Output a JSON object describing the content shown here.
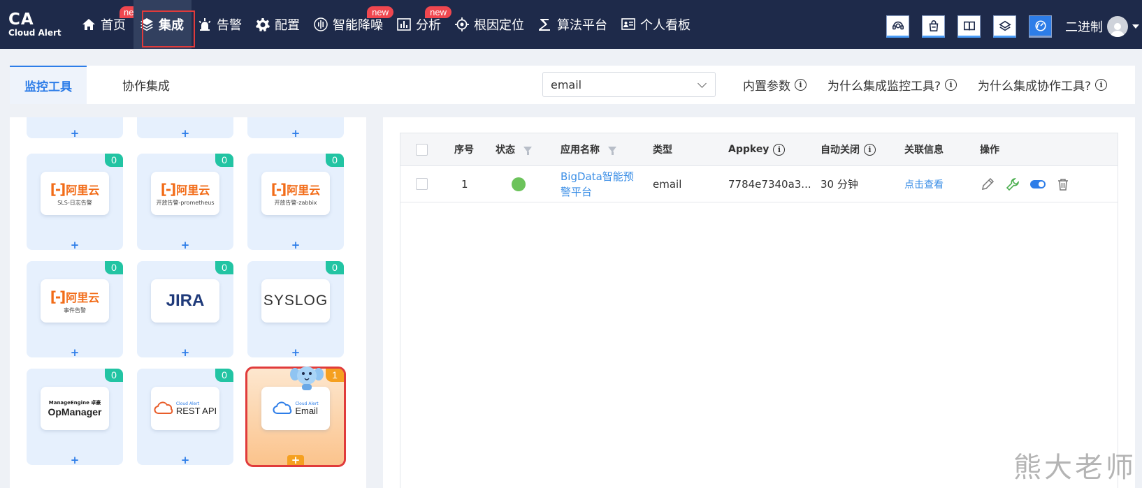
{
  "logo": {
    "big": "CA",
    "small": "Cloud Alert"
  },
  "nav": [
    {
      "label": "首页",
      "icon": "home-icon",
      "badge": "ne"
    },
    {
      "label": "集成",
      "icon": "layers-icon",
      "active": true
    },
    {
      "label": "告警",
      "icon": "alarm-icon"
    },
    {
      "label": "配置",
      "icon": "gear-icon"
    },
    {
      "label": "智能降噪",
      "icon": "waveform-icon",
      "badge": "new"
    },
    {
      "label": "分析",
      "icon": "bar-chart-icon",
      "badge": "new"
    },
    {
      "label": "根因定位",
      "icon": "target-icon"
    },
    {
      "label": "算法平台",
      "icon": "algorithm-icon"
    },
    {
      "label": "个人看板",
      "icon": "dashboard-icon"
    }
  ],
  "toolbar_icons": [
    "support-icon",
    "bag-icon",
    "book-icon",
    "layers-icon",
    "speed-icon"
  ],
  "user": {
    "name": "二进制"
  },
  "tabs": {
    "monitor": "监控工具",
    "collab": "协作集成"
  },
  "search": {
    "value": "email"
  },
  "links": {
    "builtin": "内置参数",
    "why_monitor": "为什么集成监控工具?",
    "why_collab": "为什么集成协作工具?"
  },
  "cards": {
    "plus": "+",
    "c1": {
      "count": "0",
      "brand": "阿里云",
      "sub": "SLS-日志告警"
    },
    "c2": {
      "count": "0",
      "brand": "阿里云",
      "sub": "开放告警-prometheus"
    },
    "c3": {
      "count": "0",
      "brand": "阿里云",
      "sub": "开放告警-zabbix"
    },
    "c4": {
      "count": "0",
      "brand": "阿里云",
      "sub": "事件告警"
    },
    "c5": {
      "count": "0",
      "brand": "JIRA"
    },
    "c6": {
      "count": "0",
      "brand": "SYSLOG"
    },
    "c7": {
      "count": "0",
      "brand_small": "ManageEngine 卓豪",
      "brand": "OpManager"
    },
    "c8": {
      "count": "0",
      "brand_small": "Cloud Alert",
      "brand": "REST API"
    },
    "c9": {
      "count": "1",
      "brand_small": "Cloud Alert",
      "brand": "Email"
    }
  },
  "table": {
    "headers": {
      "seq": "序号",
      "status": "状态",
      "app": "应用名称",
      "type": "类型",
      "appkey": "Appkey",
      "autoclose": "自动关闭",
      "related": "关联信息",
      "ops": "操作"
    },
    "rows": [
      {
        "seq": "1",
        "status": "green",
        "app": "BigData智能预警平台",
        "type": "email",
        "appkey": "7784e7340a3...",
        "autoclose": "30 分钟",
        "related": "点击查看"
      }
    ]
  },
  "watermark": "熊大老师",
  "colors": {
    "nav_bg": "#1e2a4a",
    "accent": "#2d7de8",
    "badge": "#f0474f",
    "teal": "#22c4a3",
    "orange": "#f5a020"
  }
}
